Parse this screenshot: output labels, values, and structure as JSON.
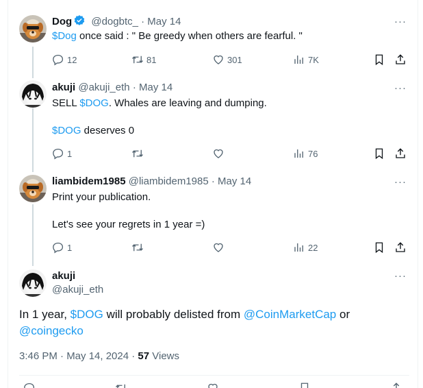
{
  "replies": [
    {
      "name": "Dog",
      "handle": "@dogbtc_",
      "dot": "·",
      "date": "May 14",
      "text_link": "$Dog",
      "text_rest": " once said :  \" Be greedy when others are fearful. \"",
      "replies_count": "12",
      "retweets_count": "81",
      "likes_count": "301",
      "views_count": "7K"
    },
    {
      "name": "akuji",
      "handle": "@akuji_eth",
      "dot": "·",
      "date": "May 14",
      "line1_pre": "SELL ",
      "line1_link": "$DOG",
      "line1_post": ". Whales are leaving and dumping.",
      "line2_link": "$DOG",
      "line2_post": " deserves 0",
      "replies_count": "1",
      "views_count": "76"
    },
    {
      "name": "liambidem1985",
      "handle": "@liambidem1985",
      "dot": "·",
      "date": "May 14",
      "line1": "Print your publication.",
      "line2": "Let's see your regrets in 1 year =)",
      "replies_count": "1",
      "views_count": "22"
    }
  ],
  "main_post": {
    "name": "akuji",
    "handle": "@akuji_eth",
    "t1": "In 1 year, ",
    "t2": "$DOG",
    "t3": " will probably delisted from ",
    "t4": "@CoinMarketCap",
    "t5": " or",
    "t6": "@coingecko",
    "timestamp": "3:46 PM · May 14, 2024 · ",
    "views_count": "57",
    "views_label": " Views"
  },
  "more_label": "···",
  "colors": {
    "link": "#1d9bf0",
    "muted": "#536471",
    "verified": "#1d9bf0",
    "line": "#cfd9de"
  },
  "icons": [
    "reply-icon",
    "retweet-icon",
    "like-icon",
    "views-icon",
    "bookmark-icon",
    "share-icon",
    "more-icon",
    "verified-badge-icon"
  ]
}
